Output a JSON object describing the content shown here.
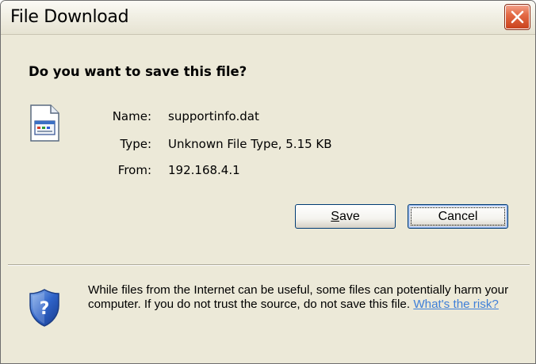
{
  "window": {
    "title": "File Download"
  },
  "dialog": {
    "question": "Do you want to save this file?",
    "fields": [
      {
        "label": "Name:",
        "value": "supportinfo.dat"
      },
      {
        "label": "Type:",
        "value": "Unknown File Type, 5.15 KB"
      },
      {
        "label": "From:",
        "value": "192.168.4.1"
      }
    ],
    "buttons": {
      "save_prefix": "S",
      "save_rest": "ave",
      "cancel": "Cancel"
    },
    "warning": {
      "text": "While files from the Internet can be useful, some files can potentially harm your computer. If you do not trust the source, do not save this file.",
      "link": "What's the risk?"
    }
  },
  "icons": {
    "close": "close-icon",
    "file": "file-icon",
    "shield": "security-shield-icon"
  },
  "colors": {
    "window_bg": "#ece9d8",
    "close_button": "#e46a45",
    "button_border": "#003c74",
    "link": "#3f7fd8"
  }
}
